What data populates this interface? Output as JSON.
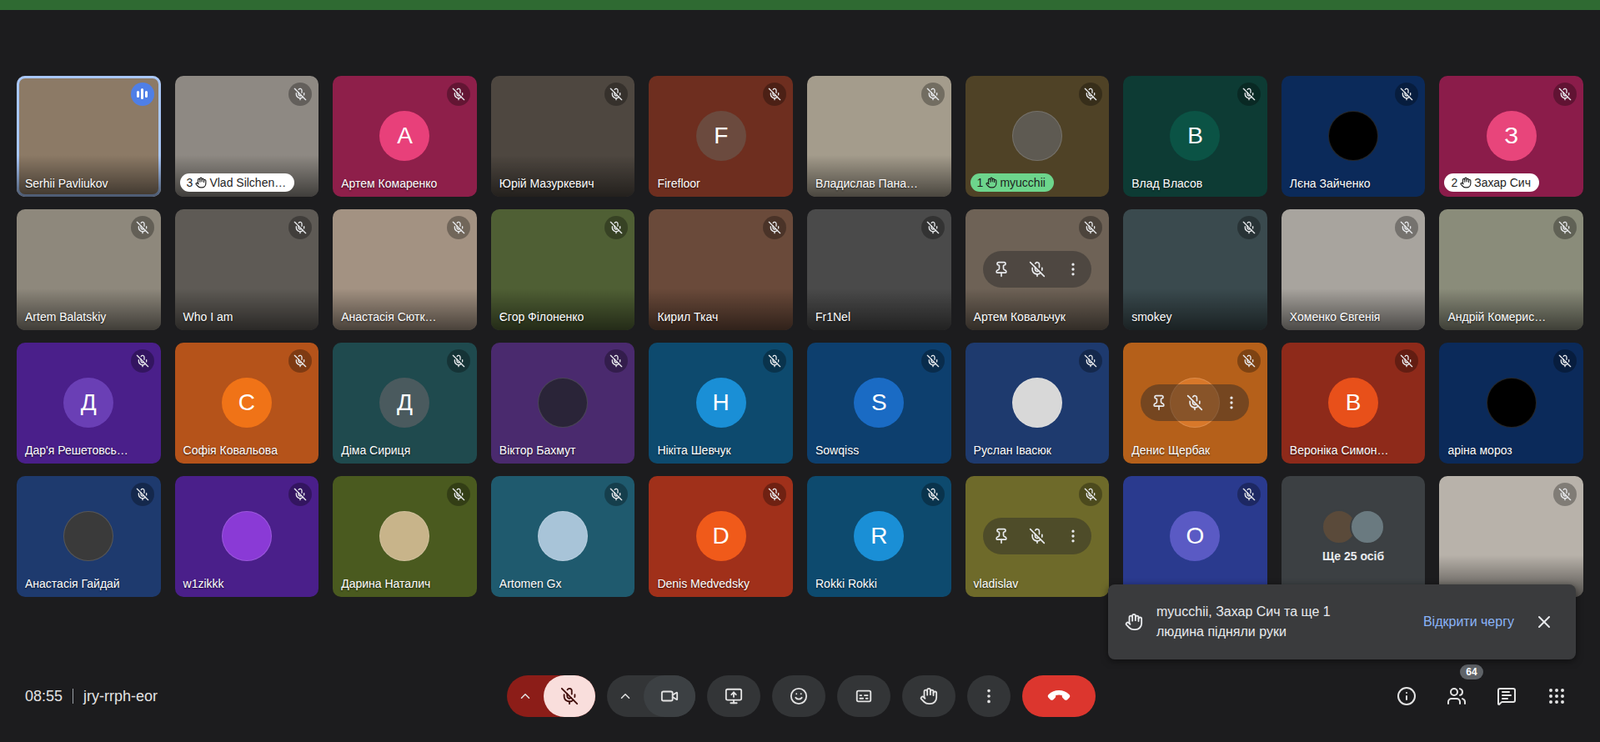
{
  "meeting": {
    "time": "08:55",
    "code": "jry-rrph-eor"
  },
  "controls": {
    "micOn": false,
    "cameraOn": true,
    "handRaised": false,
    "captionsOn": false
  },
  "people": {
    "count": "64"
  },
  "tiles": [
    {
      "kind": "video",
      "name": "Serhii Pavliukov",
      "color": "#8c7a66",
      "muted": false,
      "speaking": true,
      "hovered": false
    },
    {
      "kind": "video",
      "name": "Vlad Silchen…",
      "color": "#8e8983",
      "muted": true,
      "speaking": false,
      "hovered": false,
      "hand": "3",
      "handColor": "#ffffff"
    },
    {
      "kind": "letter",
      "name": "Артем Комаренко",
      "color": "#8e1f4a",
      "letter": "А",
      "avatarColor": "#e8407a",
      "muted": true,
      "speaking": false,
      "hovered": false
    },
    {
      "kind": "video",
      "name": "Юрій Мазуркевич",
      "color": "#4e4740",
      "muted": true,
      "speaking": false,
      "hovered": false
    },
    {
      "kind": "letter",
      "name": "Firefloor",
      "color": "#6e2e1f",
      "letter": "F",
      "avatarColor": "#6b4a3e",
      "muted": true,
      "speaking": false,
      "hovered": false
    },
    {
      "kind": "video",
      "name": "Владислав Пана…",
      "color": "#a49c8c",
      "muted": true,
      "speaking": false,
      "hovered": false
    },
    {
      "kind": "image",
      "name": "myucchii",
      "color": "#4f4226",
      "avatarColor": "#5e5a52",
      "muted": true,
      "speaking": false,
      "hovered": false,
      "hand": "1",
      "handColor": "#6dd58c"
    },
    {
      "kind": "letter",
      "name": "Влад Власов",
      "color": "#0d3b34",
      "letter": "B",
      "avatarColor": "#0b5345",
      "muted": true,
      "speaking": false,
      "hovered": false
    },
    {
      "kind": "image",
      "name": "Лєна Зайченко",
      "color": "#0b2a5a",
      "avatarColor": "#000000",
      "muted": true,
      "speaking": false,
      "hovered": false
    },
    {
      "kind": "letter",
      "name": "Захар Сич",
      "color": "#8b1c4a",
      "letter": "З",
      "avatarColor": "#e8457b",
      "muted": true,
      "speaking": false,
      "hovered": false,
      "hand": "2",
      "handColor": "#ffffff"
    },
    {
      "kind": "video",
      "name": "Artem Balatskiy",
      "color": "#8e887c",
      "muted": true,
      "speaking": false,
      "hovered": false
    },
    {
      "kind": "video",
      "name": "Who I am",
      "color": "#5e5a55",
      "muted": true,
      "speaking": false,
      "hovered": false
    },
    {
      "kind": "video",
      "name": "Анастасія Сютк…",
      "color": "#a39282",
      "muted": true,
      "speaking": false,
      "hovered": false
    },
    {
      "kind": "video",
      "name": "Єгор Філоненко",
      "color": "#4f5f34",
      "muted": true,
      "speaking": false,
      "hovered": false
    },
    {
      "kind": "video",
      "name": "Кирил Ткач",
      "color": "#6a4a3a",
      "muted": true,
      "speaking": false,
      "hovered": false
    },
    {
      "kind": "video",
      "name": "Fr1Nel",
      "color": "#4a4a4a",
      "muted": true,
      "speaking": false,
      "hovered": false
    },
    {
      "kind": "video",
      "name": "Артем Ковальчук",
      "color": "#6e6256",
      "muted": true,
      "speaking": false,
      "hovered": true
    },
    {
      "kind": "video",
      "name": "smokey",
      "color": "#3a4a4e",
      "muted": true,
      "speaking": false,
      "hovered": false
    },
    {
      "kind": "video",
      "name": "Хоменко Євгенія",
      "color": "#a8a49e",
      "muted": true,
      "speaking": false,
      "hovered": false
    },
    {
      "kind": "video",
      "name": "Андрій Комерис…",
      "color": "#8a8c7a",
      "muted": true,
      "speaking": false,
      "hovered": false
    },
    {
      "kind": "letter",
      "name": "Дар'я Решетовсь…",
      "color": "#4a1f8a",
      "letter": "Д",
      "avatarColor": "#6a3fb5",
      "muted": true,
      "speaking": false,
      "hovered": false
    },
    {
      "kind": "letter",
      "name": "Софія Ковальова",
      "color": "#b5531a",
      "letter": "С",
      "avatarColor": "#f07317",
      "muted": true,
      "speaking": false,
      "hovered": false
    },
    {
      "kind": "letter",
      "name": "Діма Сириця",
      "color": "#1f4a4e",
      "letter": "Д",
      "avatarColor": "#4a5a5e",
      "muted": true,
      "speaking": false,
      "hovered": false
    },
    {
      "kind": "image",
      "name": "Віктор Бахмут",
      "color": "#4a2a6e",
      "avatarColor": "#2a2438",
      "muted": true,
      "speaking": false,
      "hovered": false
    },
    {
      "kind": "letter",
      "name": "Нікіта Шевчук",
      "color": "#0d4a6e",
      "letter": "Н",
      "avatarColor": "#1a8fd6",
      "muted": true,
      "speaking": false,
      "hovered": false
    },
    {
      "kind": "letter",
      "name": "Sowqiss",
      "color": "#0d3f6e",
      "letter": "S",
      "avatarColor": "#1a6bc4",
      "muted": true,
      "speaking": false,
      "hovered": false
    },
    {
      "kind": "image",
      "name": "Руслан Івасюк",
      "color": "#1e3a6e",
      "avatarColor": "#d8d8d8",
      "muted": true,
      "speaking": false,
      "hovered": false
    },
    {
      "kind": "image",
      "name": "Денис Щербак",
      "color": "#b5601a",
      "avatarColor": "#d8782a",
      "muted": true,
      "speaking": false,
      "hovered": true
    },
    {
      "kind": "letter",
      "name": "Вероніка Симон…",
      "color": "#8e2a1a",
      "letter": "В",
      "avatarColor": "#e8501a",
      "muted": true,
      "speaking": false,
      "hovered": false
    },
    {
      "kind": "image",
      "name": "аріна мороз",
      "color": "#0b2a5a",
      "avatarColor": "#000000",
      "muted": true,
      "speaking": false,
      "hovered": false
    },
    {
      "kind": "image",
      "name": "Анастасія Гайдай",
      "color": "#1e3a6e",
      "avatarColor": "#3a3a3a",
      "muted": true,
      "speaking": false,
      "hovered": false
    },
    {
      "kind": "image",
      "name": "w1zikkk",
      "color": "#4a1f8a",
      "avatarColor": "#8a3ad6",
      "muted": true,
      "speaking": false,
      "hovered": false
    },
    {
      "kind": "image",
      "name": "Дарина Наталич",
      "color": "#4a5a1f",
      "avatarColor": "#c8b48a",
      "muted": true,
      "speaking": false,
      "hovered": false
    },
    {
      "kind": "image",
      "name": "Artomen Gx",
      "color": "#1f5a6e",
      "avatarColor": "#a8c4d8",
      "muted": true,
      "speaking": false,
      "hovered": false
    },
    {
      "kind": "letter",
      "name": "Denis Medvedsky",
      "color": "#a0301a",
      "letter": "D",
      "avatarColor": "#f05a1a",
      "muted": true,
      "speaking": false,
      "hovered": false
    },
    {
      "kind": "letter",
      "name": "Rokki Rokki",
      "color": "#0d4a6e",
      "letter": "R",
      "avatarColor": "#1a8fd6",
      "muted": true,
      "speaking": false,
      "hovered": false
    },
    {
      "kind": "blank",
      "name": "vladislav",
      "color": "#6e6a2a",
      "muted": true,
      "speaking": false,
      "hovered": true
    },
    {
      "kind": "letter",
      "color": "#2a3a8e",
      "letter": "O",
      "avatarColor": "#5a5ac4",
      "muted": true,
      "speaking": false,
      "hovered": false
    },
    {
      "kind": "more",
      "color": "#3c4043",
      "label": "Ще 25 осіб",
      "avatarColors": [
        "#5a4a3a",
        "#6a7a80"
      ],
      "muted": false,
      "speaking": false,
      "hovered": false
    },
    {
      "kind": "video",
      "color": "#b8b2aa",
      "muted": true,
      "speaking": false,
      "hovered": false
    }
  ],
  "toast": {
    "text": "myucchii, Захар Сич та ще 1 людина підняли руки",
    "action": "Відкрити чергу"
  }
}
